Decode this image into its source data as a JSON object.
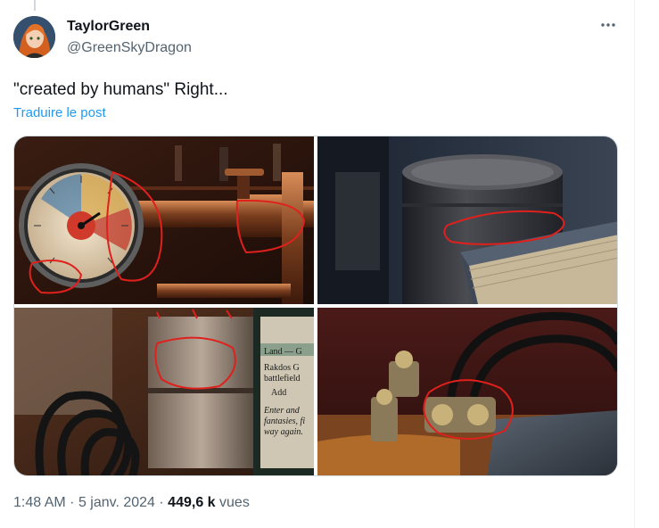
{
  "author": {
    "display_name": "TaylorGreen",
    "handle": "@GreenSkyDragon"
  },
  "more_icon": "more-horizontal-icon",
  "tweet": {
    "text": "\"created by humans\" Right...",
    "translate_label": "Traduire le post"
  },
  "media": {
    "images": [
      {
        "name": "pressure-gauge-and-pipes"
      },
      {
        "name": "cylinder-and-book"
      },
      {
        "name": "coiled-cable-and-card"
      },
      {
        "name": "cables-and-bolts-on-block"
      }
    ],
    "annotation_color": "#e0201c",
    "card_text": {
      "type_line": "Land — G",
      "title": "Rakdos G",
      "line1": "battlefield",
      "ability": "Add",
      "flavor1": "Enter and",
      "flavor2": "fantasies, fi",
      "flavor3": "way again."
    }
  },
  "meta": {
    "time": "1:48 AM",
    "separator": "·",
    "date": "5 janv. 2024",
    "views_count": "449,6 k",
    "views_label": "vues"
  },
  "colors": {
    "link": "#1d9bf0",
    "secondary_text": "#536471",
    "primary_text": "#0f1419"
  }
}
